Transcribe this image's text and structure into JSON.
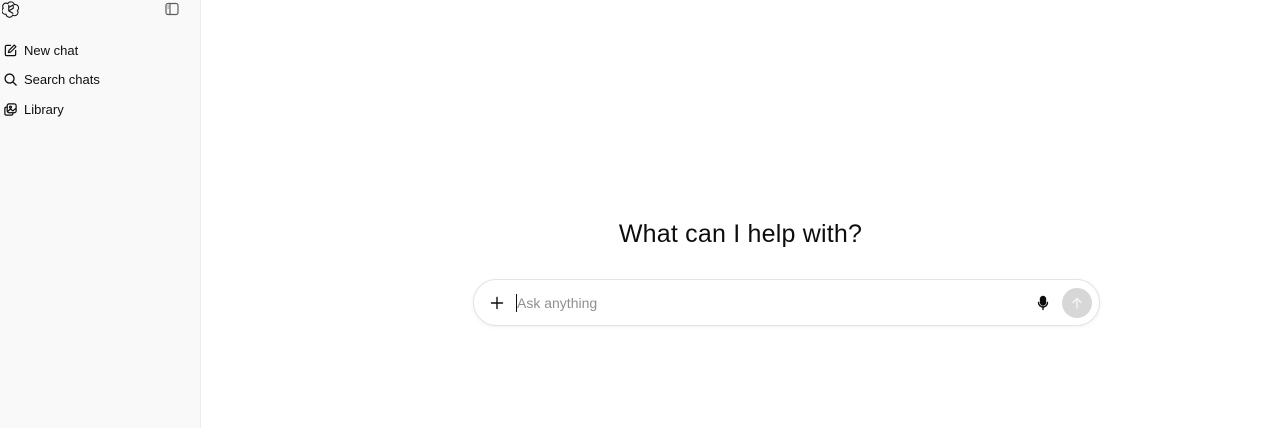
{
  "sidebar": {
    "logo_icon": "openai-logo-icon",
    "collapse_icon": "sidebar-toggle-icon",
    "items": [
      {
        "label": "New chat",
        "icon": "edit-icon"
      },
      {
        "label": "Search chats",
        "icon": "search-icon"
      },
      {
        "label": "Library",
        "icon": "images-icon"
      }
    ]
  },
  "main": {
    "headline": "What can I help with?",
    "composer": {
      "placeholder": "Ask anything",
      "value": "",
      "plus_icon": "plus-icon",
      "mic_icon": "microphone-icon",
      "send_icon": "arrow-up-icon"
    }
  },
  "colors": {
    "sidebar_bg": "#f9f9f9",
    "send_button_disabled": "#d7d7d7",
    "text": "#0d0d0d",
    "placeholder": "#8f8f8f"
  }
}
